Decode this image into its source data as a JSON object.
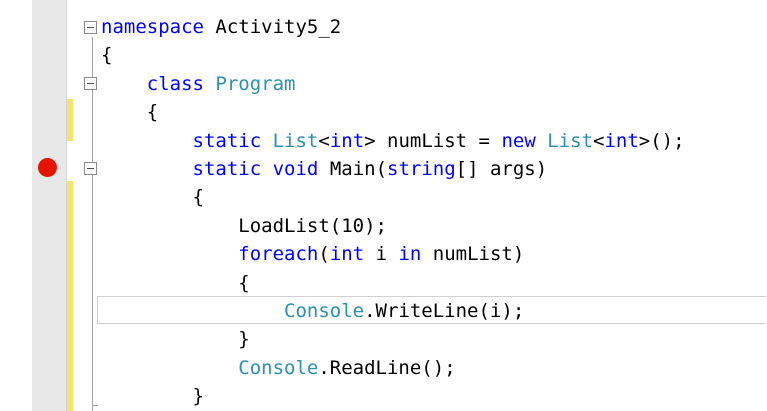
{
  "editor": {
    "breakpoint_line": 6,
    "current_line": 12,
    "colors": {
      "keyword": "#0000ff",
      "type": "#2b91af",
      "text": "#000000",
      "breakpoint": "#e51400",
      "changed_line_marker": "#f6e36c"
    },
    "lines": [
      {
        "indent": "",
        "tokens": [
          {
            "t": "namespace",
            "k": "kw"
          },
          {
            "t": " Activity5_2"
          }
        ]
      },
      {
        "indent": "",
        "tokens": [
          {
            "t": "{"
          }
        ]
      },
      {
        "indent": "    ",
        "tokens": [
          {
            "t": "class",
            "k": "kw"
          },
          {
            "t": " "
          },
          {
            "t": "Program",
            "k": "type"
          }
        ]
      },
      {
        "indent": "    ",
        "tokens": [
          {
            "t": "{"
          }
        ]
      },
      {
        "indent": "        ",
        "tokens": [
          {
            "t": "static",
            "k": "kw"
          },
          {
            "t": " "
          },
          {
            "t": "List",
            "k": "type"
          },
          {
            "t": "<"
          },
          {
            "t": "int",
            "k": "kw"
          },
          {
            "t": "> numList = "
          },
          {
            "t": "new",
            "k": "kw"
          },
          {
            "t": " "
          },
          {
            "t": "List",
            "k": "type"
          },
          {
            "t": "<"
          },
          {
            "t": "int",
            "k": "kw"
          },
          {
            "t": ">();"
          }
        ]
      },
      {
        "indent": "        ",
        "tokens": [
          {
            "t": "static",
            "k": "kw"
          },
          {
            "t": " "
          },
          {
            "t": "void",
            "k": "kw"
          },
          {
            "t": " Main("
          },
          {
            "t": "string",
            "k": "kw"
          },
          {
            "t": "[] args)"
          }
        ]
      },
      {
        "indent": "        ",
        "tokens": [
          {
            "t": "{"
          }
        ]
      },
      {
        "indent": "            ",
        "tokens": [
          {
            "t": "LoadList(10);"
          }
        ]
      },
      {
        "indent": "            ",
        "tokens": [
          {
            "t": "foreach",
            "k": "kw"
          },
          {
            "t": "("
          },
          {
            "t": "int",
            "k": "kw"
          },
          {
            "t": " i "
          },
          {
            "t": "in",
            "k": "kw"
          },
          {
            "t": " numList)"
          }
        ]
      },
      {
        "indent": "            ",
        "tokens": [
          {
            "t": "{"
          }
        ]
      },
      {
        "indent": "                ",
        "tokens": [
          {
            "t": "Console",
            "k": "type"
          },
          {
            "t": ".WriteLine(i);"
          }
        ]
      },
      {
        "indent": "            ",
        "tokens": [
          {
            "t": "}"
          }
        ]
      },
      {
        "indent": "            ",
        "tokens": [
          {
            "t": "Console",
            "k": "type"
          },
          {
            "t": ".ReadLine();"
          }
        ]
      },
      {
        "indent": "        ",
        "tokens": [
          {
            "t": "}"
          }
        ]
      }
    ]
  }
}
